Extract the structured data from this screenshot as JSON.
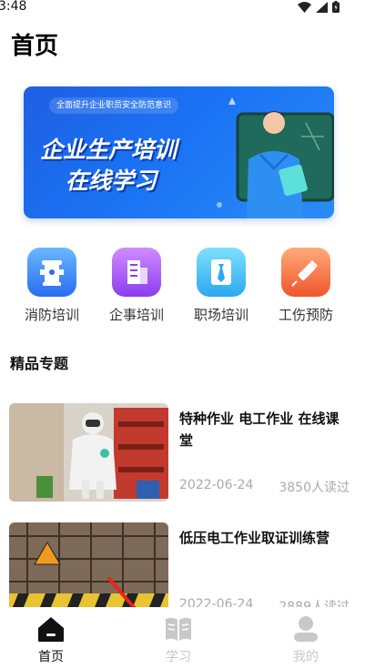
{
  "status": {
    "time": "3:48"
  },
  "page": {
    "title": "首页"
  },
  "banner": {
    "subtitle": "全面提升企业职员安全防范意识",
    "line1": "企业生产培训",
    "line2": "在线学习"
  },
  "categories": [
    {
      "label": "消防培训",
      "icon": "fire-hydrant-icon",
      "colors": [
        "#6ab8ff",
        "#2a6cf0"
      ]
    },
    {
      "label": "企事培训",
      "icon": "building-icon",
      "colors": [
        "#d08cff",
        "#8a3df0"
      ]
    },
    {
      "label": "职场培训",
      "icon": "suit-tie-icon",
      "colors": [
        "#7fe0ff",
        "#2aa8f0"
      ]
    },
    {
      "label": "工伤预防",
      "icon": "syringe-icon",
      "colors": [
        "#ffab7a",
        "#f0552a"
      ]
    }
  ],
  "section": {
    "title": "精品专题"
  },
  "articles": [
    {
      "title": "特种作业 电工作业 在线课堂",
      "date": "2022-06-24",
      "reads": "3850人读过"
    },
    {
      "title": "低压电工作业取证训练营",
      "date": "2022-06-24",
      "reads": "2889人读过"
    }
  ],
  "tabs": [
    {
      "label": "首页",
      "icon": "home-icon",
      "active": true
    },
    {
      "label": "学习",
      "icon": "book-icon",
      "active": false
    },
    {
      "label": "我的",
      "icon": "user-icon",
      "active": false
    }
  ],
  "colors": {
    "active_tab": "#111111",
    "inactive_tab": "#c8c8c8",
    "annotation_arrow": "#e8231f"
  }
}
